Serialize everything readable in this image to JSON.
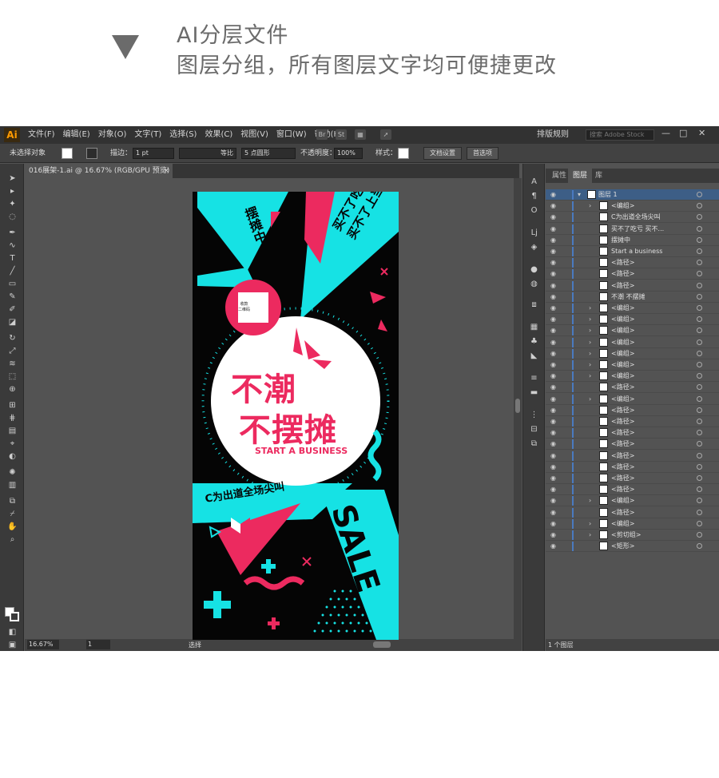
{
  "header": {
    "line1": "AI分层文件",
    "line2": "图层分组，所有图层文字均可便捷更改"
  },
  "app": {
    "logo": "Ai",
    "menus": [
      "文件(F)",
      "编辑(E)",
      "对象(O)",
      "文字(T)",
      "选择(S)",
      "效果(C)",
      "视图(V)",
      "窗口(W)",
      "帮助(H)"
    ],
    "arrange": "排版规则",
    "stock_placeholder": "搜索 Adobe Stock",
    "options": {
      "no_selection": "未选择对象",
      "stroke_label": "描边：",
      "stroke_value": "1 pt",
      "stroke_style": "等比",
      "brush": "5 点圆形",
      "opacity_label": "不透明度：",
      "opacity_value": "100%",
      "style_label": "样式：",
      "doc_setup": "文档设置",
      "prefs": "首选项"
    },
    "doc_tab": "016展架-1.ai @ 16.67% (RGB/GPU 预览)",
    "doc_tab_close": "×",
    "status": {
      "zoom": "16.67%",
      "page": "1",
      "mode": "选择"
    }
  },
  "panel": {
    "tabs": [
      "属性",
      "图层",
      "库"
    ],
    "active_tab": "图层",
    "layers": [
      "图层 1",
      "<编组>",
      "C为出道全场尖叫",
      "买不了吃亏 买不...",
      "摆摊中",
      "Start a business",
      "<路径>",
      "<路径>",
      "<路径>",
      "不潮 不摆摊",
      "<编组>",
      "<编组>",
      "<编组>",
      "<编组>",
      "<编组>",
      "<编组>",
      "<编组>",
      "<路径>",
      "<编组>",
      "<路径>",
      "<路径>",
      "<路径>",
      "<路径>",
      "<路径>",
      "<路径>",
      "<路径>",
      "<路径>",
      "<编组>",
      "<路径>",
      "<编组>",
      "<剪切组>",
      "<矩形>"
    ],
    "footer": "1 个图层"
  },
  "artwork": {
    "big1": "不潮",
    "big2": "不摆摊",
    "start": "START A BUSINESS",
    "cv": "C为出道全场尖叫",
    "sale": "SALE",
    "vert1": "摆摊中",
    "vert2a": "买不了吃亏",
    "vert2b": "买不了上当",
    "qr1": "收款",
    "qr2": "二维码",
    "colors": {
      "pink": "#ec2a5f",
      "cyan": "#16e2e4",
      "black": "#050505"
    }
  }
}
